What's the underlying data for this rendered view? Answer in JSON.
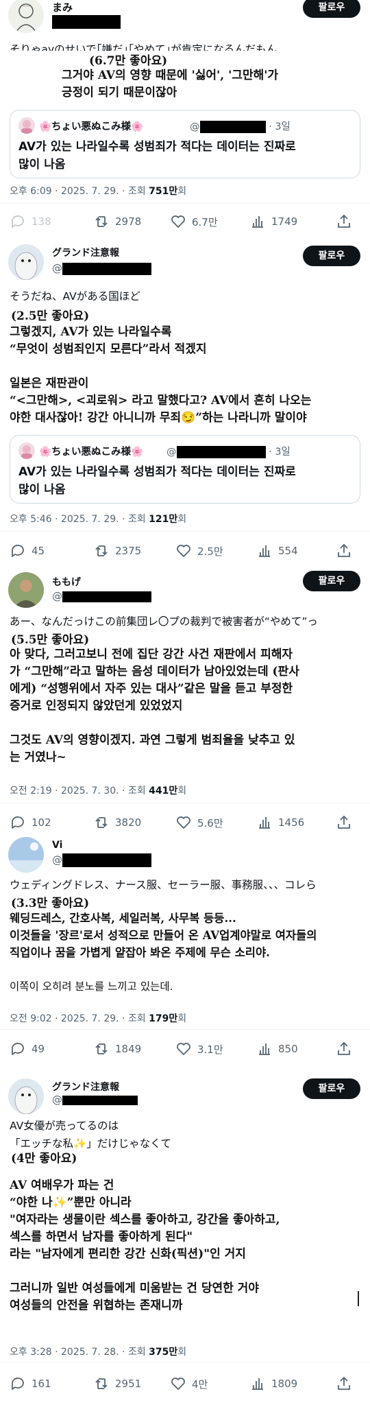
{
  "header": {
    "follow_label": "팔로우"
  },
  "icons": {
    "reply": "reply-icon",
    "retweet": "retweet-icon",
    "like": "heart-icon",
    "views": "views-icon",
    "share": "share-icon"
  },
  "colors": {
    "text": "#0f1419",
    "secondary": "#536471",
    "follow_bg": "#0f1419",
    "border": "#cfd9de"
  },
  "posts": [
    {
      "name": "まみ",
      "handle_prefix": "",
      "jp_text": "そりゃavのせいで｢嫌だ｣｢やめて｣が肯定になるんだもん",
      "likes_note": "(6.7만 좋아요)",
      "ko_lines": [
        "그거야 AV의 영향 때문에 '싫어', '그만해'가",
        "긍정이 되기 때문이잖아"
      ],
      "quote": {
        "name": "🌸ちょい悪ぬこみ様🌸",
        "handle_prefix": "@",
        "time": "· 3일",
        "lines": [
          "AV가 있는 나라일수록 성범죄가 적다는 데이터는 진짜로",
          "많이 나옴"
        ]
      },
      "meta_prefix": "오후 6:09 · 2025. 7. 29. · 조회 ",
      "views": "751만",
      "views_suffix": "회",
      "stats": {
        "reply": "138",
        "retweet": "2978",
        "like": "6.7만",
        "views": "1749"
      }
    },
    {
      "name": "グランド注意報",
      "handle_prefix": "@",
      "jp_text": "そうだね、AVがある国ほど",
      "likes_note": "(2.5만 좋아요)",
      "ko_lines": [
        "그렇겠지, AV가 있는 나라일수록",
        "“무엇이 성범죄인지 모른다”라서 적겠지",
        "",
        "일본은 재판관이",
        "“<그만해>, <괴로워> 라고 말했다고? AV에서 흔히 나오는",
        "야한 대사잖아! 강간 아니니까 무죄😏”하는 나라니까 말이야"
      ],
      "quote": {
        "name": "🌸ちょい悪ぬこみ様🌸",
        "handle_prefix": "@",
        "time": "· 3일",
        "lines": [
          "AV가 있는 나라일수록 성범죄가 적다는 데이터는 진짜로",
          "많이 나옴"
        ]
      },
      "meta_prefix": "오후 5:46 · 2025. 7. 29. · 조회 ",
      "views": "121만",
      "views_suffix": "회",
      "stats": {
        "reply": "45",
        "retweet": "2375",
        "like": "2.5만",
        "views": "554"
      }
    },
    {
      "name": "ももげ",
      "handle_prefix": "@",
      "jp_text": "あー、なんだっけこの前集団レ〇プの裁判で被害者が“やめて”っ",
      "likes_note": "(5.5만 좋아요)",
      "ko_lines": [
        "아 맞다, 그러고보니 전에 집단 강간 사건 재판에서 피해자",
        "가 “그만해”라고 말하는 음성 데이터가 남아있었는데 (판사",
        "에게) “성행위에서 자주 있는 대사”같은 말을 듣고 부정한",
        "증거로 인정되지 않았던게 있었었지",
        "",
        "그것도 AV의 영향이겠지. 과연 그렇게 범죄율을 낮추고 있",
        "는 거였나~"
      ],
      "meta_prefix": "오전 2:19 · 2025. 7. 30. · 조회 ",
      "views": "441만",
      "views_suffix": "회",
      "stats": {
        "reply": "102",
        "retweet": "3820",
        "like": "5.6만",
        "views": "1456"
      }
    },
    {
      "name": "Vi",
      "handle_prefix": "@",
      "jp_text": "ウェディングドレス、ナース服、セーラー服、事務服、、、コレら",
      "likes_note": "(3.3만 좋아요)",
      "ko_lines": [
        "웨딩드레스, 간호사복, 세일러복, 사무복 등등...",
        "이것들을 '장르'로서 성적으로 만들어 온 AV업계야말로 여자들의",
        "직업이나 꿈을 가볍게 얕잡아 봐온 주제에 무슨 소리야.",
        "",
        "이쪽이 오히려 분노를 느끼고 있는데."
      ],
      "meta_prefix": "오전 9:02 · 2025. 7. 29. · 조회 ",
      "views": "179만",
      "views_suffix": "회",
      "stats": {
        "reply": "49",
        "retweet": "1849",
        "like": "3.1만",
        "views": "850"
      }
    },
    {
      "name": "グランド注意報",
      "handle_prefix": "@",
      "jp_lines": [
        "AV女優が売ってるのは",
        "「エッチな私✨」だけじゃなくて"
      ],
      "likes_note": "(4만 좋아요)",
      "ko_lines": [
        "AV 여배우가 파는 건",
        "“야한 나✨”뿐만 아니라",
        "\"여자라는 생물이란 섹스를 좋아하고, 강간을 좋아하고,",
        "섹스를 하면서 남자를 좋아하게 된다\"",
        "라는 \"남자에게 편리한 강간 신화(픽션)\"인 거지",
        "",
        "그러니까 일반 여성들에게 미움받는 건 당연한 거야",
        "여성들의 안전을 위협하는 존재니까"
      ],
      "meta_prefix": "오후 3:28 · 2025. 7. 28. · 조회 ",
      "views": "375만",
      "views_suffix": "회",
      "stats": {
        "reply": "161",
        "retweet": "2951",
        "like": "4만",
        "views": "1809"
      }
    }
  ]
}
